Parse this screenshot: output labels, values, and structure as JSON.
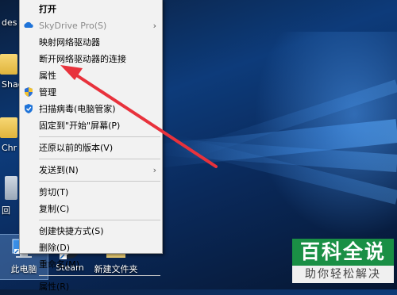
{
  "desktop": {
    "left_edge_labels": [
      "des",
      "Shad",
      "Chr",
      "回"
    ],
    "icons": [
      {
        "label": "此电脑"
      },
      {
        "label": "Steam"
      },
      {
        "label": "新建文件夹"
      }
    ]
  },
  "context_menu": {
    "items": [
      {
        "label": "打开"
      },
      {
        "label": "SkyDrive Pro(S)"
      },
      {
        "label": "映射网络驱动器"
      },
      {
        "label": "断开网络驱动器的连接"
      },
      {
        "label": "属性"
      },
      {
        "label": "管理"
      },
      {
        "label": "扫描病毒(电脑管家)"
      },
      {
        "label": "固定到\"开始\"屏幕(P)"
      },
      {
        "label": "还原以前的版本(V)"
      },
      {
        "label": "发送到(N)"
      },
      {
        "label": "剪切(T)"
      },
      {
        "label": "复制(C)"
      },
      {
        "label": "创建快捷方式(S)"
      },
      {
        "label": "删除(D)"
      },
      {
        "label": "重命名(M)"
      },
      {
        "label": "属性(R)"
      }
    ],
    "submenu_arrow": "›"
  },
  "annotation": {
    "color": "#e8323c"
  },
  "watermark": {
    "title": "百科全说",
    "subtitle": "助你轻松解决",
    "color": "#1a8f45"
  }
}
